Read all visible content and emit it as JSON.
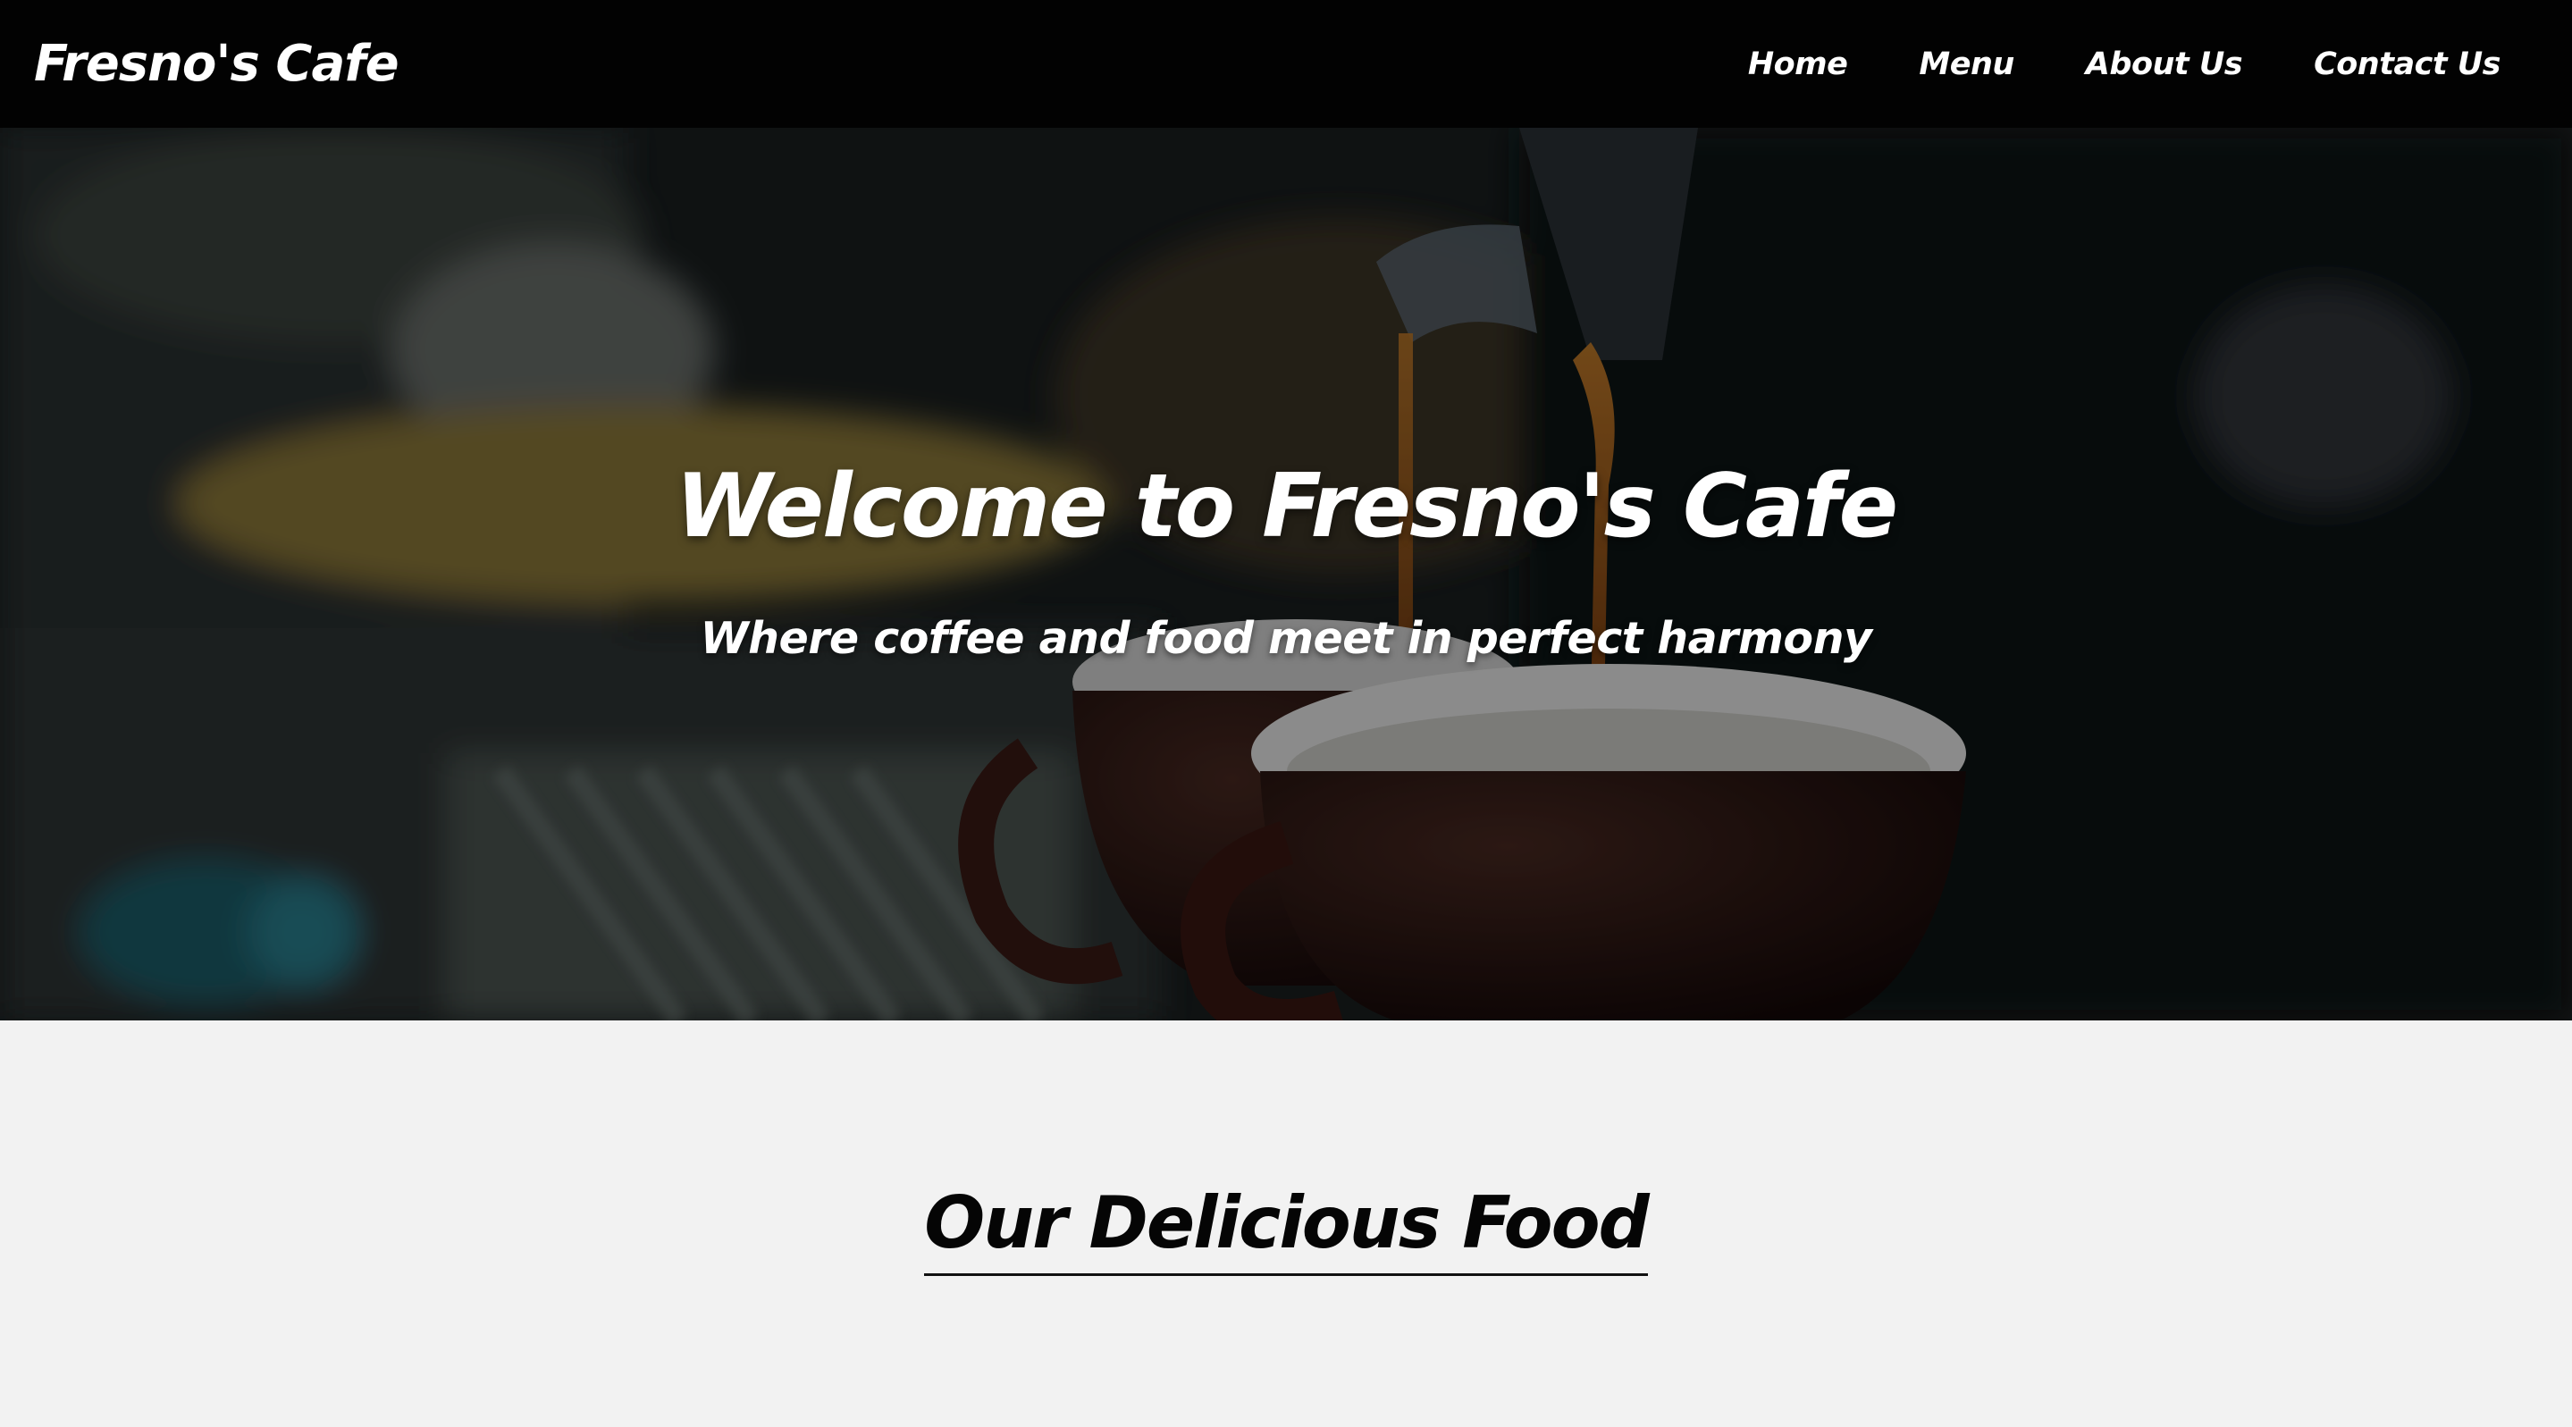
{
  "brand": {
    "name": "Fresno's Cafe"
  },
  "nav": {
    "items": [
      {
        "label": "Home"
      },
      {
        "label": "Menu"
      },
      {
        "label": "About Us"
      },
      {
        "label": "Contact Us"
      }
    ]
  },
  "hero": {
    "title": "Welcome to Fresno's Cafe",
    "subtitle": "Where coffee and food meet in perfect harmony",
    "image": "espresso-pouring-into-cups"
  },
  "food_section": {
    "heading": "Our Delicious Food"
  },
  "colors": {
    "navbar": "#020202",
    "nav_text": "#ffffff",
    "section_bg": "#f2f2f2",
    "heading_text": "#050505"
  }
}
